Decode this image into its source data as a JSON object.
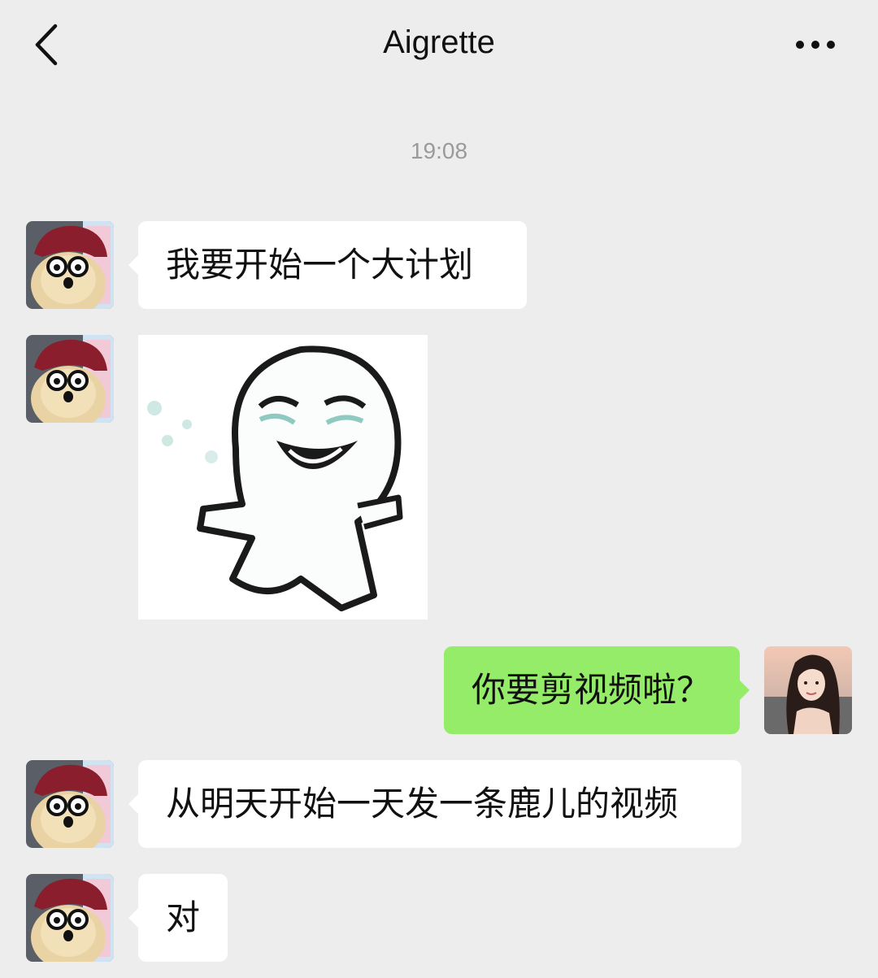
{
  "header": {
    "title": "Aigrette",
    "back_icon": "chevron-left-icon",
    "more_icon": "more-dots-icon"
  },
  "chat": {
    "timestamp": "19:08",
    "messages": [
      {
        "sender": "contact",
        "type": "text",
        "text": "我要开始一个大计划"
      },
      {
        "sender": "contact",
        "type": "sticker",
        "sticker": "laughing-ghost-sticker"
      },
      {
        "sender": "me",
        "type": "text",
        "text": "你要剪视频啦？"
      },
      {
        "sender": "contact",
        "type": "text",
        "text": "从明天开始一天发一条鹿儿的视频"
      },
      {
        "sender": "contact",
        "type": "text",
        "text": "对"
      }
    ]
  },
  "colors": {
    "background": "#ededed",
    "incoming_bubble": "#ffffff",
    "outgoing_bubble": "#95ec69",
    "timestamp_text": "#9a9a9a"
  }
}
